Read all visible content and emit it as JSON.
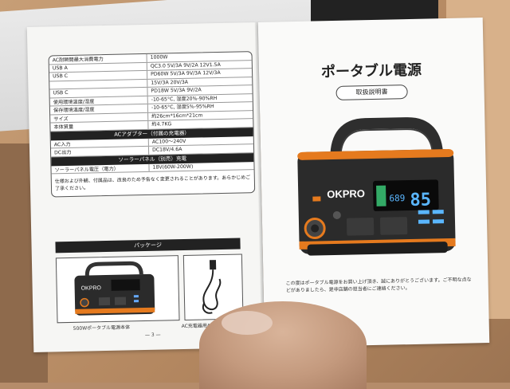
{
  "left_page": {
    "spec_rows": [
      {
        "k": "AC耐瞬間最大消費電力",
        "v": "1000W"
      },
      {
        "k": "USB A",
        "v": "QC3.0 5V/3A 9V/2A 12V1.5A"
      },
      {
        "k": "USB C",
        "v": "PD60W 5V/3A 9V/3A 12V/3A"
      },
      {
        "k": "",
        "v": "15V/3A 20V/3A"
      },
      {
        "k": "USB C",
        "v": "PD18W 5V/3A 9V/2A"
      },
      {
        "k": "使用環境温度/湿度",
        "v": "-10-65°C, 湿度20%-90%RH"
      },
      {
        "k": "保存環境温度/湿度",
        "v": "-10-65°C, 湿度5%-95%RH"
      },
      {
        "k": "サイズ",
        "v": "約26cm*16cm*21cm"
      },
      {
        "k": "本体質量",
        "v": "約4.7KG"
      }
    ],
    "adapter_band": "ACアダプター（付属の充電器）",
    "adapter_rows": [
      {
        "k": "AC入力",
        "v": "AC100～240V"
      },
      {
        "k": "DC出力",
        "v": "DC18V/4.6A"
      }
    ],
    "solar_band": "ソーラーパネル（別売）充電",
    "solar_rows": [
      {
        "k": "ソーラーパネル電圧（電力）",
        "v": "18V(60W-200W)"
      }
    ],
    "note": "仕様および外観、付属品は、改良のため予告なく変更されることがあります。あらかじめご了承ください。",
    "package_title": "パッケージ",
    "package_item_1": "500Wポータブル電源本体",
    "package_item_2": "AC充電器用ACケーブル",
    "page_number": "— 3 —",
    "mini_brand": "OKPRO"
  },
  "right_page": {
    "title": "ポータブル電源",
    "subtitle": "取扱説明書",
    "brand": "OKPRO",
    "display_small": "689",
    "display_big": "85",
    "caption": "この度はポータブル電源をお買い上げ頂き、誠にありがとうございます。ご不明な点などがありましたら、是非店舗の担当者にご連絡ください。"
  },
  "colors": {
    "accent_orange": "#e57a1e",
    "device_body": "#2b2b2b",
    "lcd_blue": "#5ab6ff"
  }
}
